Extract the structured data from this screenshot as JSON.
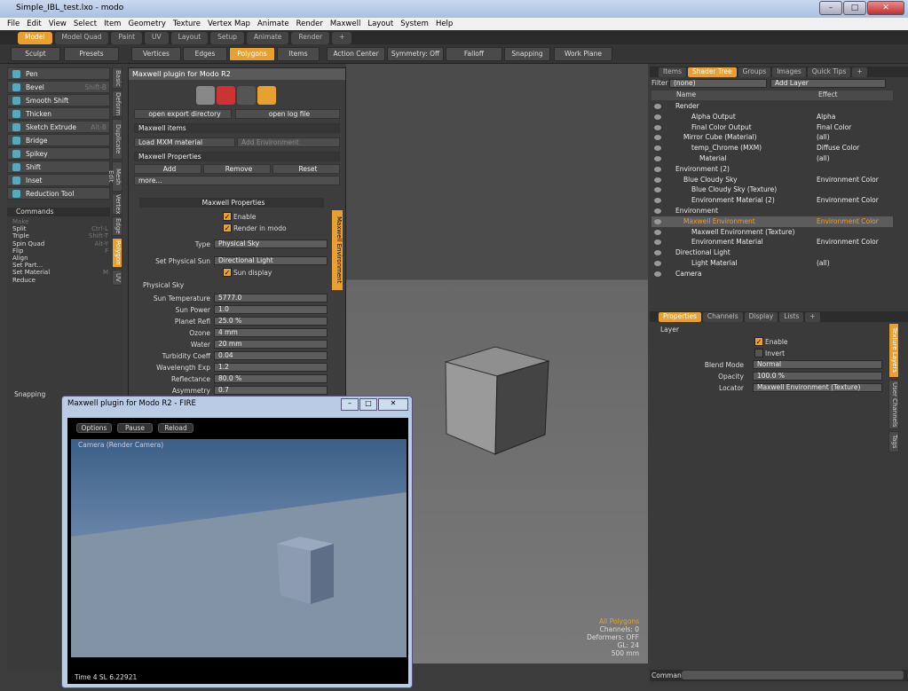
{
  "app": {
    "title": "Simple_IBL_test.lxo - modo",
    "min": "–",
    "max": "□",
    "close": "✕"
  },
  "menu": [
    "File",
    "Edit",
    "View",
    "Select",
    "Item",
    "Geometry",
    "Texture",
    "Vertex Map",
    "Animate",
    "Render",
    "Maxwell",
    "Layout",
    "System",
    "Help"
  ],
  "layouts": [
    "Model",
    "Model Quad",
    "Paint",
    "UV",
    "Layout",
    "Setup",
    "Animate",
    "Render",
    "+"
  ],
  "toolbar": {
    "sculpt": "Sculpt",
    "presets": "Presets",
    "vertices": "Vertices",
    "edges": "Edges",
    "polygons": "Polygons",
    "items": "Items",
    "action_center": "Action Center",
    "symmetry": "Symmetry: Off",
    "falloff": "Falloff",
    "snapping": "Snapping",
    "work_plane": "Work Plane"
  },
  "tools": [
    {
      "label": "Pen",
      "sc": ""
    },
    {
      "label": "Bevel",
      "sc": "Shift-B"
    },
    {
      "label": "Smooth Shift",
      "sc": ""
    },
    {
      "label": "Thicken",
      "sc": ""
    },
    {
      "label": "Sketch Extrude",
      "sc": "Alt-B"
    },
    {
      "label": "Bridge",
      "sc": ""
    },
    {
      "label": "Spikey",
      "sc": ""
    },
    {
      "label": "Shift",
      "sc": ""
    },
    {
      "label": "Inset",
      "sc": ""
    },
    {
      "label": "Reduction Tool",
      "sc": ""
    }
  ],
  "commands_header": "Commands",
  "commands": [
    {
      "label": "Make",
      "sc": ""
    },
    {
      "label": "Split",
      "sc": "Ctrl-L"
    },
    {
      "label": "Triple",
      "sc": "Shift-T"
    },
    {
      "label": "Spin Quad",
      "sc": "Alt-Y"
    },
    {
      "label": "Flip",
      "sc": "F"
    },
    {
      "label": "Align",
      "sc": ""
    },
    {
      "label": "Set Part...",
      "sc": ""
    },
    {
      "label": "Set Material",
      "sc": "M"
    },
    {
      "label": "Reduce",
      "sc": ""
    }
  ],
  "vtabs": [
    "Basic",
    "Deform",
    "Duplicate",
    "Mesh Edit",
    "Vertex",
    "Edge",
    "Polygon",
    "UV"
  ],
  "snapping": "Snapping",
  "maxwell": {
    "title": "Maxwell plugin for Modo R2",
    "open_export": "open export directory",
    "open_log": "open log file",
    "items_header": "Maxwell items",
    "load_mxm": "Load MXM material",
    "add_env": "Add Environment",
    "props_header": "Maxwell Properties",
    "add": "Add",
    "remove": "Remove",
    "reset": "Reset",
    "more": "more...",
    "props_title": "Maxwell Properties",
    "enable": "Enable",
    "render_in_modo": "Render in modo",
    "type_label": "Type",
    "type_value": "Physical Sky",
    "sun_label": "Set Physical Sun",
    "sun_value": "Directional Light",
    "sun_display": "Sun display",
    "physical_sky": "Physical Sky",
    "side_tab": "Maxwell Environment",
    "fields": [
      {
        "label": "Sun Temperature",
        "value": "5777.0"
      },
      {
        "label": "Sun Power",
        "value": "1.0"
      },
      {
        "label": "Planet Refl",
        "value": "25.0 %"
      },
      {
        "label": "Ozone",
        "value": "4 mm"
      },
      {
        "label": "Water",
        "value": "20 mm"
      },
      {
        "label": "Turbidity Coeff",
        "value": "0.04"
      },
      {
        "label": "Wavelength Exp",
        "value": "1.2"
      },
      {
        "label": "Reflectance",
        "value": "80.0 %"
      },
      {
        "label": "Asymmetry",
        "value": "0.7"
      }
    ]
  },
  "right_tabs": [
    "Items",
    "Shader Tree",
    "Groups",
    "Images",
    "Quick Tips",
    "+"
  ],
  "shader": {
    "filter_label": "Filter",
    "filter_value": "(none)",
    "add_layer": "Add Layer",
    "col_name": "Name",
    "col_effect": "Effect",
    "rows": [
      {
        "name": "Render",
        "effect": "",
        "indent": 1
      },
      {
        "name": "Alpha Output",
        "effect": "Alpha",
        "indent": 3
      },
      {
        "name": "Final Color Output",
        "effect": "Final Color",
        "indent": 3
      },
      {
        "name": "Mirror Cube (Material)",
        "effect": "(all)",
        "indent": 2
      },
      {
        "name": "temp_Chrome (MXM)",
        "effect": "Diffuse Color",
        "indent": 3
      },
      {
        "name": "Material",
        "effect": "(all)",
        "indent": 4
      },
      {
        "name": "Environment (2)",
        "effect": "",
        "indent": 1
      },
      {
        "name": "Blue Cloudy Sky",
        "effect": "Environment Color",
        "indent": 2
      },
      {
        "name": "Blue Cloudy Sky (Texture)",
        "effect": "",
        "indent": 3
      },
      {
        "name": "Environment Material (2)",
        "effect": "Environment Color",
        "indent": 3
      },
      {
        "name": "Environment",
        "effect": "",
        "indent": 1
      },
      {
        "name": "Maxwell Environment",
        "effect": "Environment Color",
        "indent": 2
      },
      {
        "name": "Maxwell Environment (Texture)",
        "effect": "",
        "indent": 3
      },
      {
        "name": "Environment Material",
        "effect": "Environment Color",
        "indent": 3
      },
      {
        "name": "Directional Light",
        "effect": "",
        "indent": 1
      },
      {
        "name": "Light Material",
        "effect": "(all)",
        "indent": 3
      },
      {
        "name": "Camera",
        "effect": "",
        "indent": 1
      }
    ]
  },
  "prop_tabs": [
    "Properties",
    "Channels",
    "Display",
    "Lists",
    "+"
  ],
  "props": {
    "layer": "Layer",
    "enable": "Enable",
    "invert": "Invert",
    "blend_label": "Blend Mode",
    "blend_value": "Normal",
    "opacity_label": "Opacity",
    "opacity_value": "100.0 %",
    "locator_label": "Locator",
    "locator_value": "Maxwell Environment (Texture)",
    "side_tabs": [
      "Texture Layers",
      "User Channels",
      "Tags"
    ]
  },
  "viewport_status": [
    "All Polygons",
    "Channels: 0",
    "Deformers: OFF",
    "GL: 24",
    "500 mm"
  ],
  "command_label": "Command",
  "fire": {
    "title": "Maxwell plugin for Modo R2 - FIRE",
    "options": "Options",
    "pause": "Pause",
    "reload": "Reload",
    "camera": "Camera    (Render Camera)",
    "time": "Time  4    SL  6.22921"
  }
}
